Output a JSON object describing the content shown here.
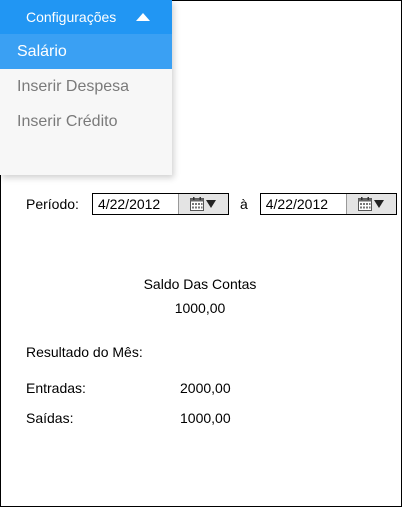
{
  "menu": {
    "header": "Configurações",
    "items": [
      {
        "label": "Salário",
        "active": true
      },
      {
        "label": "Inserir Despesa",
        "active": false
      },
      {
        "label": "Inserir Crédito",
        "active": false
      }
    ]
  },
  "period": {
    "label": "Período:",
    "start_date": "4/22/2012",
    "separator": "à",
    "end_date": "4/22/2012"
  },
  "saldo": {
    "title": "Saldo Das Contas",
    "value": "1000,00"
  },
  "resultado": {
    "title": "Resultado do Mês:",
    "rows": [
      {
        "label": "Entradas:",
        "value": "2000,00"
      },
      {
        "label": "Saídas:",
        "value": "1000,00"
      }
    ]
  },
  "colors": {
    "accent": "#2196f3",
    "active_item": "#3aa0f3"
  }
}
